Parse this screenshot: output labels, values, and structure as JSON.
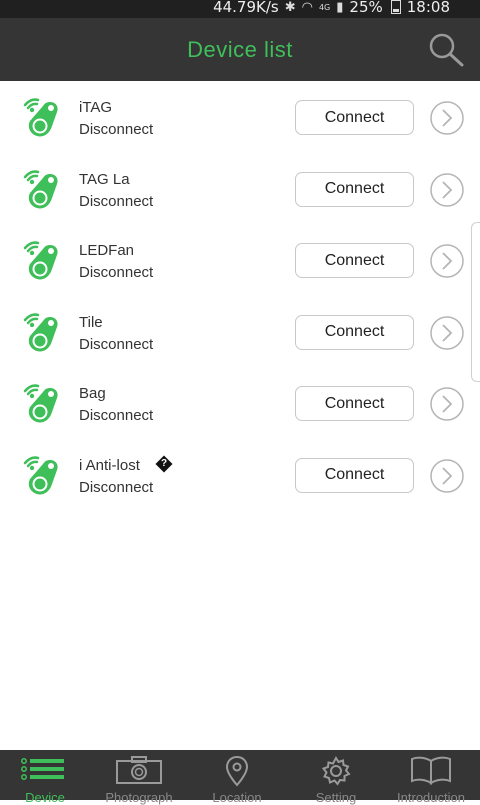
{
  "status_bar": {
    "speed": "44.79K/s",
    "battery": "25%",
    "time": "18:08",
    "network": "4G"
  },
  "header": {
    "title": "Device list",
    "accent": "#3fbf5a"
  },
  "devices": [
    {
      "name": "iTAG",
      "state": "Disconnect",
      "button": "Connect"
    },
    {
      "name": "TAG La",
      "state": "Disconnect",
      "button": "Connect"
    },
    {
      "name": "LEDFan",
      "state": "Disconnect",
      "button": "Connect"
    },
    {
      "name": "Tile",
      "state": "Disconnect",
      "button": "Connect"
    },
    {
      "name": "Bag",
      "state": "Disconnect",
      "button": "Connect"
    },
    {
      "name": "i Anti-lost",
      "state": "Disconnect",
      "button": "Connect",
      "suffix_glyph": "?"
    }
  ],
  "bottom_nav": {
    "items": [
      {
        "label": "Device",
        "icon": "list-icon",
        "active": true
      },
      {
        "label": "Photograph",
        "icon": "camera-icon",
        "active": false
      },
      {
        "label": "Location",
        "icon": "location-pin-icon",
        "active": false
      },
      {
        "label": "Setting",
        "icon": "gear-icon",
        "active": false
      },
      {
        "label": "Introduction",
        "icon": "book-icon",
        "active": false
      }
    ]
  }
}
